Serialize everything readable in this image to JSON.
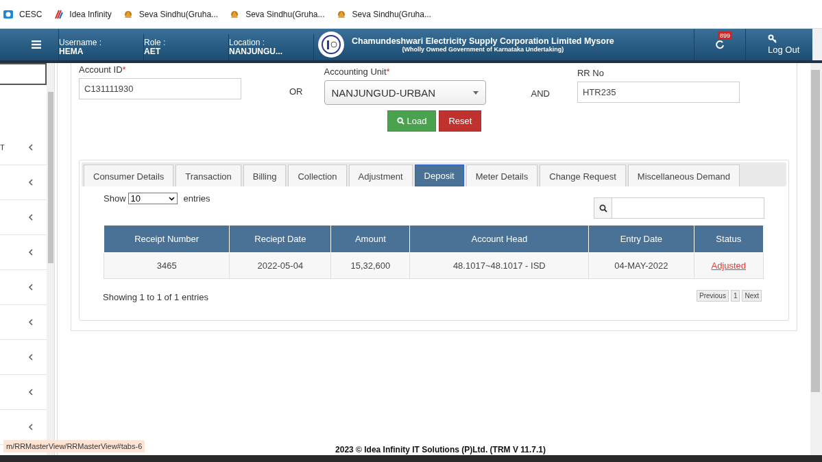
{
  "bookmarks": [
    {
      "kind": "cesc",
      "label": "CESC"
    },
    {
      "kind": "idea",
      "label": "Idea Infinity"
    },
    {
      "kind": "seva",
      "label": "Seva Sindhu(Gruha..."
    },
    {
      "kind": "seva",
      "label": "Seva Sindhu(Gruha..."
    },
    {
      "kind": "seva",
      "label": "Seva Sindhu(Gruha..."
    }
  ],
  "header": {
    "user_info": [
      {
        "label": "Username :",
        "value": "HEMA"
      },
      {
        "label": "Role :",
        "value": "AET"
      },
      {
        "label": "Location :",
        "value": "NANJUNGU..."
      }
    ],
    "org_title": "Chamundeshwari Electricity Supply Corporation Limited Mysore",
    "org_subtitle": "(Wholly Owned Government of Karnataka Undertaking)",
    "notification_count": "899",
    "logout": "Log Out"
  },
  "sidebar": {
    "items": [
      {
        "label": "T",
        "expanded": false
      },
      {
        "expanded": false
      },
      {
        "expanded": false
      },
      {
        "expanded": false
      },
      {
        "expanded": false
      },
      {
        "expanded": false
      },
      {
        "expanded": false
      },
      {
        "expanded": false
      },
      {
        "expanded": false
      }
    ]
  },
  "form": {
    "account_id": {
      "label": "Account ID",
      "required_mark": "*",
      "value": "C131111930"
    },
    "or_label": "OR",
    "accounting_unit": {
      "label": "Accounting Unit",
      "required_mark": "*",
      "value": "NANJUNGUD-URBAN"
    },
    "and_label": "AND",
    "rr_no": {
      "label": "RR No",
      "value": "HTR235"
    },
    "buttons": [
      {
        "kind": "load",
        "label": "Load"
      },
      {
        "kind": "reset",
        "label": "Reset"
      }
    ]
  },
  "tabs": [
    {
      "label": "Consumer Details",
      "selected": false
    },
    {
      "label": "Transaction",
      "selected": false
    },
    {
      "label": "Billing",
      "selected": false
    },
    {
      "label": "Collection",
      "selected": false
    },
    {
      "label": "Adjustment",
      "selected": false
    },
    {
      "label": "Deposit",
      "selected": true
    },
    {
      "label": "Meter Details",
      "selected": false
    },
    {
      "label": "Change Request",
      "selected": false
    },
    {
      "label": "Miscellaneous Demand",
      "selected": false
    }
  ],
  "table": {
    "show_label": "Show",
    "page_length": "10",
    "entries_label": "entries",
    "columns": [
      "Receipt Number",
      "Reciept Date",
      "Amount",
      "Account Head",
      "Entry Date",
      "Status"
    ],
    "rows": [
      {
        "cells": [
          "3465",
          "2022-05-04",
          "15,32,600",
          "48.1017~48.1017 - ISD",
          "04-MAY-2022",
          "Adjusted"
        ]
      }
    ],
    "info": "Showing 1 to 1 of 1 entries",
    "pagination": [
      "Previous",
      "1",
      "Next"
    ]
  },
  "status_url": "m/RRMasterView/RRMasterView#tabs-6",
  "footer": "2023 © Idea Infinity IT Solutions (P)Ltd. (TRM V 11.7.1)"
}
